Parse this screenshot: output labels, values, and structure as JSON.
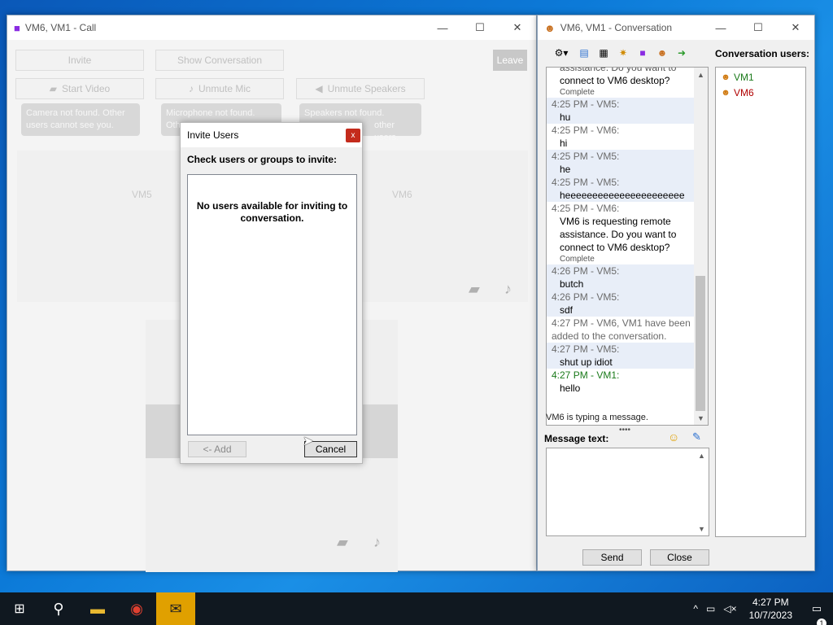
{
  "call_window": {
    "title": "VM6, VM1 - Call",
    "buttons": {
      "invite": "Invite",
      "show_conversation": "Show Conversation",
      "leave": "Leave",
      "start_video": "Start Video",
      "unmute_mic": "Unmute Mic",
      "unmute_speakers": "Unmute Speakers"
    },
    "tips": {
      "camera": "Camera not found. Other users cannot see you.",
      "mic_line1": "Microphone not found.",
      "mic_line2": "Oth",
      "speakers_line1": "Speakers not found.",
      "speakers_line2": "other users."
    },
    "participants": [
      "VM5",
      "VM6"
    ]
  },
  "invite_dialog": {
    "title": "Invite Users",
    "close": "x",
    "prompt": "Check users or groups to invite:",
    "empty_message": "No users available for inviting to conversation.",
    "add_button": "<- Add",
    "cancel_button": "Cancel"
  },
  "conversation_window": {
    "title": "VM6, VM1 - Conversation",
    "users_label": "Conversation users:",
    "users": [
      {
        "name": "VM1",
        "color": "#1a7a1a"
      },
      {
        "name": "VM6",
        "color": "#b00000"
      }
    ],
    "messages": [
      {
        "header": "",
        "text": "connect to VM6 desktop?",
        "note": "Complete",
        "alt": false,
        "partial": "assistance. Do you want to"
      },
      {
        "header": "4:25 PM - VM5:",
        "text": "hu",
        "alt": true
      },
      {
        "header": "4:25 PM - VM6:",
        "text": "hi",
        "alt": false
      },
      {
        "header": "4:25 PM - VM5:",
        "text": "he",
        "alt": true
      },
      {
        "header": "4:25 PM - VM5:",
        "text": "heeeeeeeeeeeeeeeeeeeeee",
        "alt": true
      },
      {
        "header": "4:25 PM - VM6:",
        "text": "VM6 is requesting remote assistance. Do you want to connect to VM6 desktop?",
        "note": "Complete",
        "alt": false
      },
      {
        "header": "4:26 PM - VM5:",
        "text": "butch",
        "alt": true
      },
      {
        "header": "4:26 PM - VM5:",
        "text": "sdf",
        "alt": true
      },
      {
        "header": "4:27 PM - VM6, VM1 have been added to the conversation.",
        "text": "",
        "alt": false
      },
      {
        "header": "4:27 PM - VM5:",
        "text": "shut up idiot",
        "alt": true
      },
      {
        "header": "4:27 PM - VM1:",
        "text": "hello",
        "alt": false,
        "me": true
      }
    ],
    "typing_status": "VM6 is typing a message.",
    "message_label": "Message text:",
    "send_button": "Send",
    "close_button": "Close"
  },
  "taskbar": {
    "time": "4:27 PM",
    "date": "10/7/2023",
    "notification_count": "1"
  }
}
